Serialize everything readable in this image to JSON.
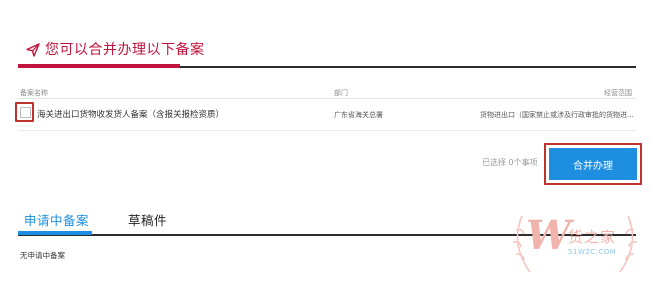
{
  "section": {
    "title": "您可以合并办理以下备案",
    "icon": "send-icon",
    "accent_color": "#c0143c"
  },
  "table": {
    "columns": [
      "备案名称",
      "部门",
      "经营范围"
    ],
    "rows": [
      {
        "name": "海关进出口货物收发货人备案（含报关报检资质）",
        "department": "广东省海关总署",
        "scope": "货物进出口（国家禁止或涉及行政审批的货物进..."
      }
    ],
    "selected_count_text": "已选择 0个事项",
    "merge_button_label": "合并办理",
    "button_color": "#1e8ee0"
  },
  "tabs": {
    "items": [
      {
        "label": "申请中备案",
        "active": true
      },
      {
        "label": "草稿件",
        "active": false
      }
    ],
    "empty_message": "无申请中备案"
  },
  "watermark": {
    "letter": "W",
    "name": "货之家",
    "url": "51W2C.COM"
  }
}
